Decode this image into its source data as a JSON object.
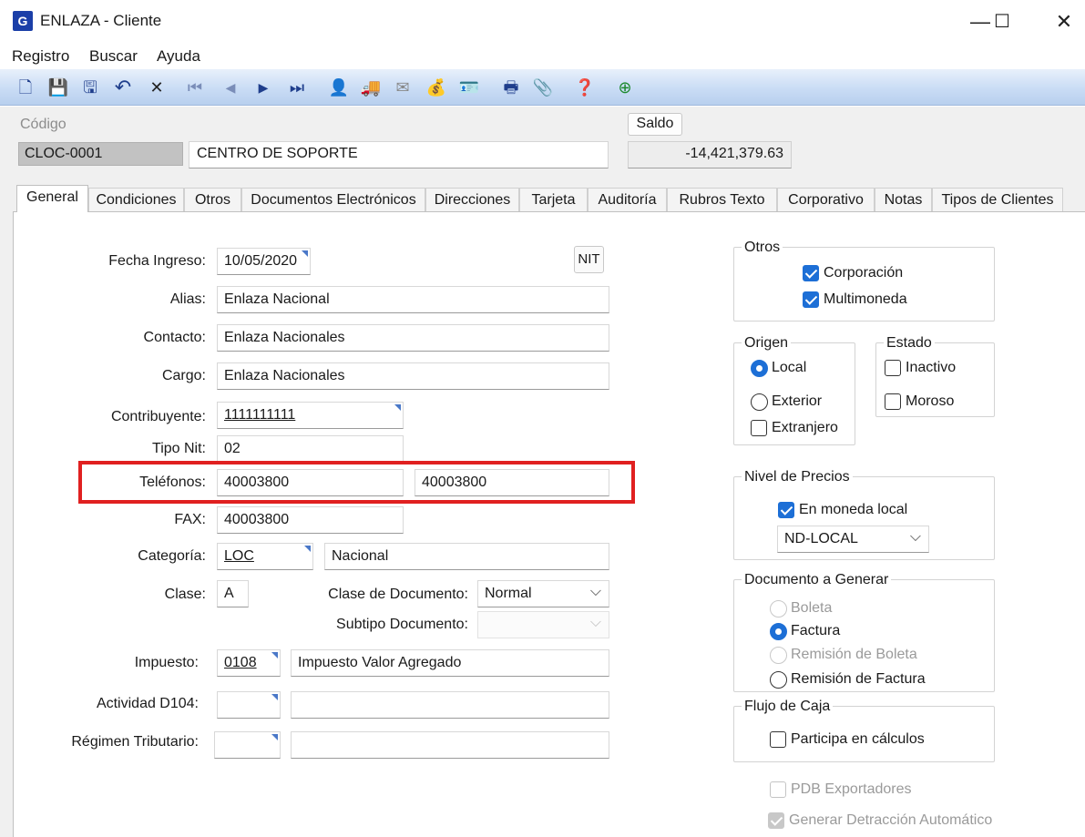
{
  "window": {
    "title": "ENLAZA - Cliente",
    "logo_text": "G",
    "min_symbol": "—",
    "max_symbol": "☐",
    "close_symbol": "✕"
  },
  "menu": [
    "Registro",
    "Buscar",
    "Ayuda"
  ],
  "toolbar": {
    "icons": [
      "new-document-icon",
      "save-icon",
      "save-close-icon",
      "undo-icon",
      "delete-icon",
      "first-record-icon",
      "previous-record-icon",
      "next-record-icon",
      "last-record-icon",
      "user-icon",
      "transfer-icon",
      "envelope-icon",
      "coins-icon",
      "card-icon",
      "printer-icon",
      "attachment-icon",
      "help-icon",
      "exit-icon"
    ],
    "glyphs": [
      "🗋",
      "💾",
      "🖫",
      "↶",
      "✕",
      "⏮",
      "◀",
      "▶",
      "⏭",
      "👤",
      "🚚",
      "✉",
      "💰",
      "🪪",
      "🖶",
      "📎",
      "❓",
      "⊕"
    ]
  },
  "header": {
    "codigo_label": "Código",
    "codigo_value": "CLOC-0001",
    "nombre_value": "CENTRO DE SOPORTE",
    "saldo_button": "Saldo",
    "saldo_value": "-14,421,379.63"
  },
  "tabs": [
    "General",
    "Condiciones",
    "Otros",
    "Documentos Electrónicos",
    "Direcciones",
    "Tarjeta",
    "Auditoría",
    "Rubros Texto",
    "Corporativo",
    "Notas",
    "Tipos de Clientes"
  ],
  "active_tab": "General",
  "form": {
    "fecha_ingreso_label": "Fecha Ingreso:",
    "fecha_ingreso_value": "10/05/2020",
    "nit_button": "NIT",
    "alias_label": "Alias:",
    "alias_value": "Enlaza Nacional",
    "contacto_label": "Contacto:",
    "contacto_value": "Enlaza Nacionales",
    "cargo_label": "Cargo:",
    "cargo_value": "Enlaza Nacionales",
    "contribuyente_label": "Contribuyente:",
    "contribuyente_value": "1111111111",
    "tipo_nit_label": "Tipo Nit:",
    "tipo_nit_value": "02",
    "telefonos_label": "Teléfonos:",
    "telefono1_value": "40003800",
    "telefono2_value": "40003800",
    "fax_label": "FAX:",
    "fax_value": "40003800",
    "categoria_label": "Categoría:",
    "categoria_code": "LOC",
    "categoria_name": "Nacional",
    "clase_label": "Clase:",
    "clase_value": "A",
    "clase_documento_label": "Clase de Documento:",
    "clase_documento_value": "Normal",
    "subtipo_documento_label": "Subtipo Documento:",
    "subtipo_documento_value": "",
    "impuesto_label": "Impuesto:",
    "impuesto_code": "0108",
    "impuesto_name": "Impuesto Valor Agregado",
    "actividad_label": "Actividad D104:",
    "actividad_code": "",
    "actividad_name": "",
    "regimen_label": "Régimen Tributario:",
    "regimen_code": "",
    "regimen_name": ""
  },
  "otros": {
    "title": "Otros",
    "corporacion_label": "Corporación",
    "corporacion_checked": true,
    "multimoneda_label": "Multimoneda",
    "multimoneda_checked": true
  },
  "origen": {
    "title": "Origen",
    "local_label": "Local",
    "exterior_label": "Exterior",
    "extranjero_label": "Extranjero",
    "selected": "Local",
    "extranjero_checked": false
  },
  "estado": {
    "title": "Estado",
    "inactivo_label": "Inactivo",
    "inactivo_checked": false,
    "moroso_label": "Moroso",
    "moroso_checked": false
  },
  "nivel_precios": {
    "title": "Nivel de Precios",
    "moneda_local_label": "En moneda local",
    "moneda_local_checked": true,
    "nivel_value": "ND-LOCAL"
  },
  "documento_generar": {
    "title": "Documento a Generar",
    "boleta_label": "Boleta",
    "factura_label": "Factura",
    "remision_boleta_label": "Remisión de Boleta",
    "remision_factura_label": "Remisión de Factura",
    "selected": "Factura"
  },
  "flujo_caja": {
    "title": "Flujo de Caja",
    "participa_label": "Participa en cálculos",
    "participa_checked": false
  },
  "extras": {
    "pdb_label": "PDB Exportadores",
    "pdb_checked": false,
    "detraccion_label": "Generar Detracción Automático",
    "detraccion_checked": true
  }
}
